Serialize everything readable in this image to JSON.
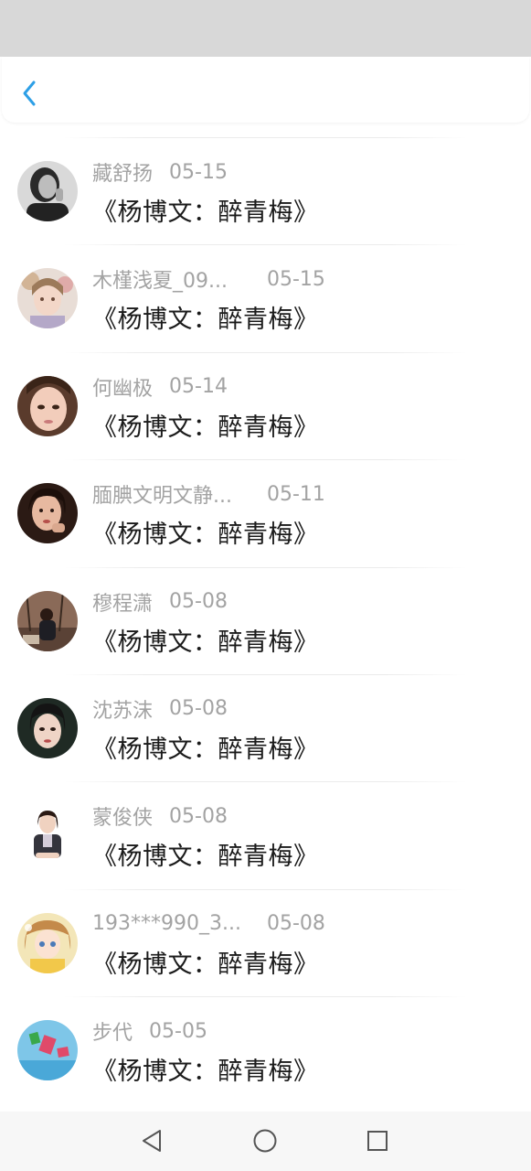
{
  "colors": {
    "accent": "#2d9fe6",
    "status_bar": "#d8d8d8",
    "meta_text": "#a3a3a3",
    "title_text": "#1a1a1a",
    "nav_bar": "#f7f7f7"
  },
  "header": {
    "back_icon": "chevron-left-icon"
  },
  "items": [
    {
      "name": "藏舒扬",
      "date": "05-15",
      "title": "《杨博文：醉青梅》"
    },
    {
      "name": "木槿浅夏_09...",
      "date": "05-15",
      "title": "《杨博文：醉青梅》"
    },
    {
      "name": "何幽极",
      "date": "05-14",
      "title": "《杨博文：醉青梅》"
    },
    {
      "name": "腼腆文明文静...",
      "date": "05-11",
      "title": "《杨博文：醉青梅》"
    },
    {
      "name": "穆程潇",
      "date": "05-08",
      "title": "《杨博文：醉青梅》"
    },
    {
      "name": "沈苏沫",
      "date": "05-08",
      "title": "《杨博文：醉青梅》"
    },
    {
      "name": "蒙俊侠",
      "date": "05-08",
      "title": "《杨博文：醉青梅》"
    },
    {
      "name": "193***990_3...",
      "date": "05-08",
      "title": "《杨博文：醉青梅》"
    },
    {
      "name": "步代",
      "date": "05-05",
      "title": "《杨博文：醉青梅》"
    }
  ],
  "nav": {
    "back_icon": "triangle-back-icon",
    "home_icon": "circle-home-icon",
    "recents_icon": "square-recents-icon"
  }
}
